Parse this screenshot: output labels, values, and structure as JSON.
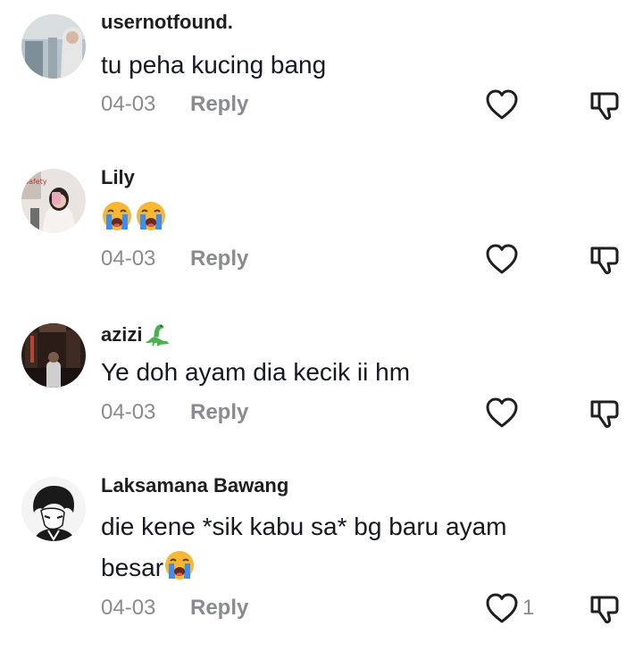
{
  "comments": [
    {
      "username": "usernotfound.",
      "text": "tu peha kucing bang",
      "date": "04-03",
      "reply_label": "Reply",
      "like_count": ""
    },
    {
      "username": "Lily",
      "text": "",
      "emoji": [
        "loudly-crying-face-emoji",
        "loudly-crying-face-emoji"
      ],
      "date": "04-03",
      "reply_label": "Reply",
      "like_count": ""
    },
    {
      "username": "azizi",
      "username_emoji": "sauropod-emoji",
      "text": "Ye doh ayam dia kecik ii hm",
      "date": "04-03",
      "reply_label": "Reply",
      "like_count": ""
    },
    {
      "username": "Laksamana Bawang",
      "text_line1": "die kene *sik kabu sa* bg baru ayam",
      "text_line2": "besar",
      "emoji": [
        "loudly-crying-face-emoji"
      ],
      "date": "04-03",
      "reply_label": "Reply",
      "like_count": "1"
    }
  ],
  "icons": {
    "like": "heart-outline-icon",
    "dislike": "thumbs-down-outline-icon"
  },
  "colors": {
    "primary_text": "#161823",
    "secondary_text": "#8a8b91",
    "icon": "#1f1f1f"
  }
}
